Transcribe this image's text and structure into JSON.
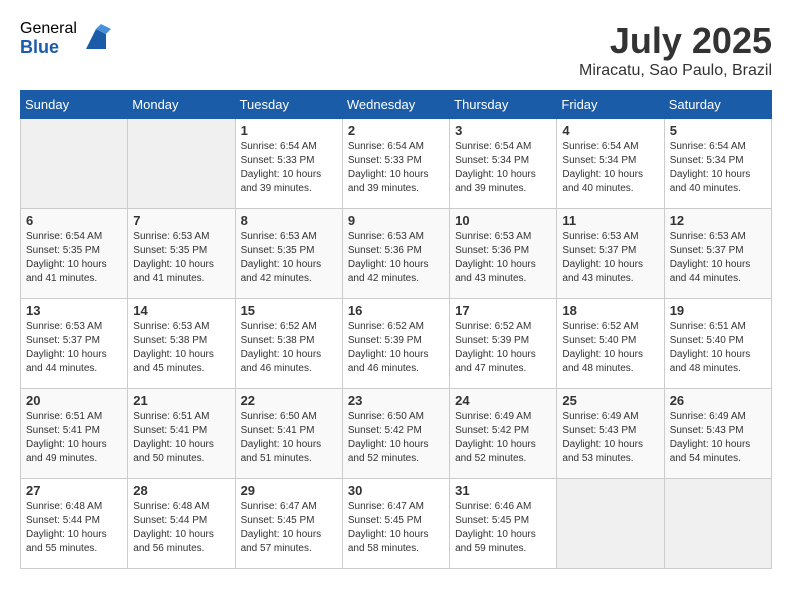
{
  "header": {
    "logo_general": "General",
    "logo_blue": "Blue",
    "month_year": "July 2025",
    "location": "Miracatu, Sao Paulo, Brazil"
  },
  "days_of_week": [
    "Sunday",
    "Monday",
    "Tuesday",
    "Wednesday",
    "Thursday",
    "Friday",
    "Saturday"
  ],
  "weeks": [
    [
      {
        "day": "",
        "sunrise": "",
        "sunset": "",
        "daylight": ""
      },
      {
        "day": "",
        "sunrise": "",
        "sunset": "",
        "daylight": ""
      },
      {
        "day": "1",
        "sunrise": "Sunrise: 6:54 AM",
        "sunset": "Sunset: 5:33 PM",
        "daylight": "Daylight: 10 hours and 39 minutes."
      },
      {
        "day": "2",
        "sunrise": "Sunrise: 6:54 AM",
        "sunset": "Sunset: 5:33 PM",
        "daylight": "Daylight: 10 hours and 39 minutes."
      },
      {
        "day": "3",
        "sunrise": "Sunrise: 6:54 AM",
        "sunset": "Sunset: 5:34 PM",
        "daylight": "Daylight: 10 hours and 39 minutes."
      },
      {
        "day": "4",
        "sunrise": "Sunrise: 6:54 AM",
        "sunset": "Sunset: 5:34 PM",
        "daylight": "Daylight: 10 hours and 40 minutes."
      },
      {
        "day": "5",
        "sunrise": "Sunrise: 6:54 AM",
        "sunset": "Sunset: 5:34 PM",
        "daylight": "Daylight: 10 hours and 40 minutes."
      }
    ],
    [
      {
        "day": "6",
        "sunrise": "Sunrise: 6:54 AM",
        "sunset": "Sunset: 5:35 PM",
        "daylight": "Daylight: 10 hours and 41 minutes."
      },
      {
        "day": "7",
        "sunrise": "Sunrise: 6:53 AM",
        "sunset": "Sunset: 5:35 PM",
        "daylight": "Daylight: 10 hours and 41 minutes."
      },
      {
        "day": "8",
        "sunrise": "Sunrise: 6:53 AM",
        "sunset": "Sunset: 5:35 PM",
        "daylight": "Daylight: 10 hours and 42 minutes."
      },
      {
        "day": "9",
        "sunrise": "Sunrise: 6:53 AM",
        "sunset": "Sunset: 5:36 PM",
        "daylight": "Daylight: 10 hours and 42 minutes."
      },
      {
        "day": "10",
        "sunrise": "Sunrise: 6:53 AM",
        "sunset": "Sunset: 5:36 PM",
        "daylight": "Daylight: 10 hours and 43 minutes."
      },
      {
        "day": "11",
        "sunrise": "Sunrise: 6:53 AM",
        "sunset": "Sunset: 5:37 PM",
        "daylight": "Daylight: 10 hours and 43 minutes."
      },
      {
        "day": "12",
        "sunrise": "Sunrise: 6:53 AM",
        "sunset": "Sunset: 5:37 PM",
        "daylight": "Daylight: 10 hours and 44 minutes."
      }
    ],
    [
      {
        "day": "13",
        "sunrise": "Sunrise: 6:53 AM",
        "sunset": "Sunset: 5:37 PM",
        "daylight": "Daylight: 10 hours and 44 minutes."
      },
      {
        "day": "14",
        "sunrise": "Sunrise: 6:53 AM",
        "sunset": "Sunset: 5:38 PM",
        "daylight": "Daylight: 10 hours and 45 minutes."
      },
      {
        "day": "15",
        "sunrise": "Sunrise: 6:52 AM",
        "sunset": "Sunset: 5:38 PM",
        "daylight": "Daylight: 10 hours and 46 minutes."
      },
      {
        "day": "16",
        "sunrise": "Sunrise: 6:52 AM",
        "sunset": "Sunset: 5:39 PM",
        "daylight": "Daylight: 10 hours and 46 minutes."
      },
      {
        "day": "17",
        "sunrise": "Sunrise: 6:52 AM",
        "sunset": "Sunset: 5:39 PM",
        "daylight": "Daylight: 10 hours and 47 minutes."
      },
      {
        "day": "18",
        "sunrise": "Sunrise: 6:52 AM",
        "sunset": "Sunset: 5:40 PM",
        "daylight": "Daylight: 10 hours and 48 minutes."
      },
      {
        "day": "19",
        "sunrise": "Sunrise: 6:51 AM",
        "sunset": "Sunset: 5:40 PM",
        "daylight": "Daylight: 10 hours and 48 minutes."
      }
    ],
    [
      {
        "day": "20",
        "sunrise": "Sunrise: 6:51 AM",
        "sunset": "Sunset: 5:41 PM",
        "daylight": "Daylight: 10 hours and 49 minutes."
      },
      {
        "day": "21",
        "sunrise": "Sunrise: 6:51 AM",
        "sunset": "Sunset: 5:41 PM",
        "daylight": "Daylight: 10 hours and 50 minutes."
      },
      {
        "day": "22",
        "sunrise": "Sunrise: 6:50 AM",
        "sunset": "Sunset: 5:41 PM",
        "daylight": "Daylight: 10 hours and 51 minutes."
      },
      {
        "day": "23",
        "sunrise": "Sunrise: 6:50 AM",
        "sunset": "Sunset: 5:42 PM",
        "daylight": "Daylight: 10 hours and 52 minutes."
      },
      {
        "day": "24",
        "sunrise": "Sunrise: 6:49 AM",
        "sunset": "Sunset: 5:42 PM",
        "daylight": "Daylight: 10 hours and 52 minutes."
      },
      {
        "day": "25",
        "sunrise": "Sunrise: 6:49 AM",
        "sunset": "Sunset: 5:43 PM",
        "daylight": "Daylight: 10 hours and 53 minutes."
      },
      {
        "day": "26",
        "sunrise": "Sunrise: 6:49 AM",
        "sunset": "Sunset: 5:43 PM",
        "daylight": "Daylight: 10 hours and 54 minutes."
      }
    ],
    [
      {
        "day": "27",
        "sunrise": "Sunrise: 6:48 AM",
        "sunset": "Sunset: 5:44 PM",
        "daylight": "Daylight: 10 hours and 55 minutes."
      },
      {
        "day": "28",
        "sunrise": "Sunrise: 6:48 AM",
        "sunset": "Sunset: 5:44 PM",
        "daylight": "Daylight: 10 hours and 56 minutes."
      },
      {
        "day": "29",
        "sunrise": "Sunrise: 6:47 AM",
        "sunset": "Sunset: 5:45 PM",
        "daylight": "Daylight: 10 hours and 57 minutes."
      },
      {
        "day": "30",
        "sunrise": "Sunrise: 6:47 AM",
        "sunset": "Sunset: 5:45 PM",
        "daylight": "Daylight: 10 hours and 58 minutes."
      },
      {
        "day": "31",
        "sunrise": "Sunrise: 6:46 AM",
        "sunset": "Sunset: 5:45 PM",
        "daylight": "Daylight: 10 hours and 59 minutes."
      },
      {
        "day": "",
        "sunrise": "",
        "sunset": "",
        "daylight": ""
      },
      {
        "day": "",
        "sunrise": "",
        "sunset": "",
        "daylight": ""
      }
    ]
  ]
}
